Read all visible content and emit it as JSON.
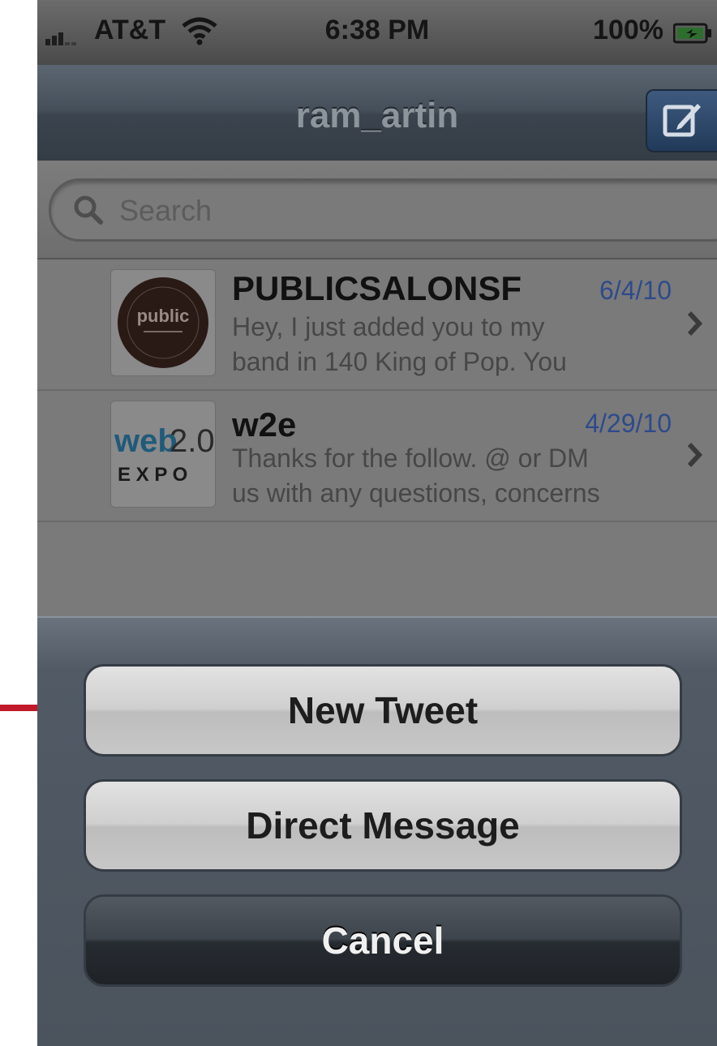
{
  "status_bar": {
    "carrier": "AT&T",
    "time": "6:38 PM",
    "battery_percent": "100%",
    "icons": [
      "signal-icon",
      "wifi-icon",
      "battery-icon"
    ]
  },
  "nav": {
    "title": "ram_artin",
    "compose_icon": "compose-icon"
  },
  "search": {
    "placeholder": "Search",
    "icon": "search-icon"
  },
  "messages": [
    {
      "sender": "PUBLICSALONSF",
      "date": "6/4/10",
      "preview_line1": "Hey, I just added you to my",
      "preview_line2": "band in 140 King of Pop. You",
      "avatar_text": "public",
      "icon": "chevron-right-icon"
    },
    {
      "sender": "w2e",
      "date": "4/29/10",
      "preview_line1": "Thanks for the follow. @ or DM",
      "preview_line2": "us with any questions, concerns",
      "avatar_text_1": "web",
      "avatar_text_2": "2.0",
      "avatar_text_3": "E X P O",
      "icon": "chevron-right-icon"
    }
  ],
  "action_sheet": {
    "new_tweet": "New Tweet",
    "direct_message": "Direct Message",
    "cancel": "Cancel"
  },
  "colors": {
    "date_blue": "#2e4a8c",
    "pointer_red": "#c21a2a",
    "nav_dark": "#3b444e"
  }
}
